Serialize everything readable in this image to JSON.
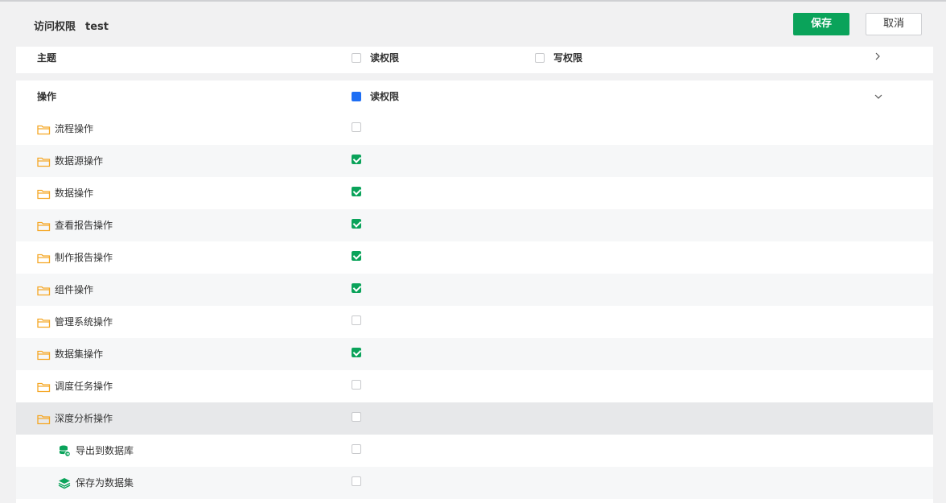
{
  "header": {
    "title": "访问权限",
    "subtitle": "test",
    "save_label": "保存",
    "cancel_label": "取消"
  },
  "colors": {
    "accent": "#0aa35a",
    "indeterminate": "#1e6ef4",
    "folder": "#f5a623"
  },
  "theme_section": {
    "label": "主题",
    "read_label": "读权限",
    "write_label": "写权限",
    "read_checked": false,
    "write_checked": false,
    "expanded": false
  },
  "ops_section": {
    "label": "操作",
    "read_label": "读权限",
    "read_state": "indeterminate",
    "expanded": true,
    "items": [
      {
        "label": "流程操作",
        "checked": false,
        "icon": "folder-icon"
      },
      {
        "label": "数据源操作",
        "checked": true,
        "icon": "folder-icon"
      },
      {
        "label": "数据操作",
        "checked": true,
        "icon": "folder-icon"
      },
      {
        "label": "查看报告操作",
        "checked": true,
        "icon": "folder-icon"
      },
      {
        "label": "制作报告操作",
        "checked": true,
        "icon": "folder-icon"
      },
      {
        "label": "组件操作",
        "checked": true,
        "icon": "folder-icon"
      },
      {
        "label": "管理系统操作",
        "checked": false,
        "icon": "folder-icon"
      },
      {
        "label": "数据集操作",
        "checked": true,
        "icon": "folder-icon"
      },
      {
        "label": "调度任务操作",
        "checked": false,
        "icon": "folder-icon"
      },
      {
        "label": "深度分析操作",
        "checked": false,
        "icon": "folder-icon"
      }
    ],
    "subitems": [
      {
        "label": "导出到数据库",
        "checked": false,
        "icon": "database-export-icon"
      },
      {
        "label": "保存为数据集",
        "checked": false,
        "icon": "layers-icon"
      }
    ]
  }
}
